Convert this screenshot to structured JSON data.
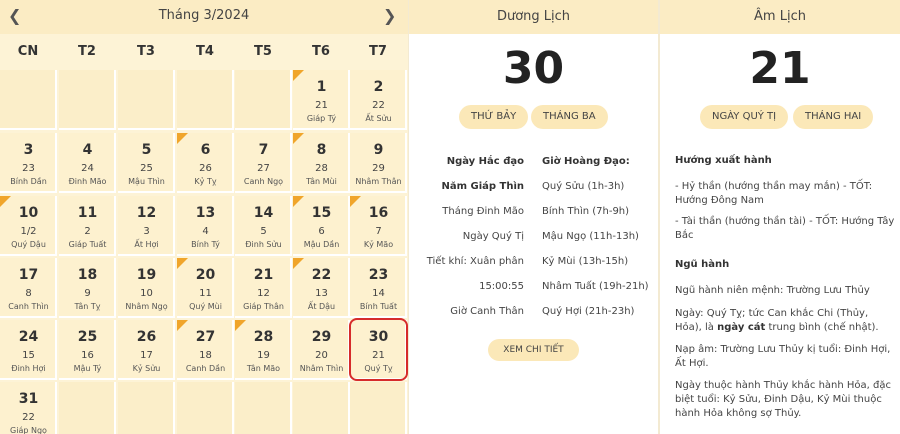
{
  "calendar": {
    "title": "Tháng 3/2024",
    "prev_icon": "chevron-left-icon",
    "next_icon": "chevron-right-icon",
    "weekdays": [
      "CN",
      "T2",
      "T3",
      "T4",
      "T5",
      "T6",
      "T7"
    ],
    "marker_color": "#f0a52b",
    "today_color": "#d62b2b",
    "days": [
      {
        "solar": "1",
        "lunar": "21",
        "canchi": "Giáp Tý",
        "marker": true
      },
      {
        "solar": "2",
        "lunar": "22",
        "canchi": "Ất Sửu",
        "marker": false
      },
      {
        "solar": "3",
        "lunar": "23",
        "canchi": "Bính Dần",
        "marker": false
      },
      {
        "solar": "4",
        "lunar": "24",
        "canchi": "Đinh Mão",
        "marker": false
      },
      {
        "solar": "5",
        "lunar": "25",
        "canchi": "Mậu Thìn",
        "marker": false
      },
      {
        "solar": "6",
        "lunar": "26",
        "canchi": "Kỷ Tỵ",
        "marker": true
      },
      {
        "solar": "7",
        "lunar": "27",
        "canchi": "Canh Ngọ",
        "marker": false
      },
      {
        "solar": "8",
        "lunar": "28",
        "canchi": "Tân Mùi",
        "marker": true
      },
      {
        "solar": "9",
        "lunar": "29",
        "canchi": "Nhâm Thân",
        "marker": false
      },
      {
        "solar": "10",
        "lunar": "1/2",
        "canchi": "Quý Dậu",
        "marker": true
      },
      {
        "solar": "11",
        "lunar": "2",
        "canchi": "Giáp Tuất",
        "marker": false
      },
      {
        "solar": "12",
        "lunar": "3",
        "canchi": "Ất Hợi",
        "marker": false
      },
      {
        "solar": "13",
        "lunar": "4",
        "canchi": "Bính Tý",
        "marker": false
      },
      {
        "solar": "14",
        "lunar": "5",
        "canchi": "Đinh Sửu",
        "marker": false
      },
      {
        "solar": "15",
        "lunar": "6",
        "canchi": "Mậu Dần",
        "marker": true
      },
      {
        "solar": "16",
        "lunar": "7",
        "canchi": "Kỷ Mão",
        "marker": true
      },
      {
        "solar": "17",
        "lunar": "8",
        "canchi": "Canh Thìn",
        "marker": false
      },
      {
        "solar": "18",
        "lunar": "9",
        "canchi": "Tân Tỵ",
        "marker": false
      },
      {
        "solar": "19",
        "lunar": "10",
        "canchi": "Nhâm Ngọ",
        "marker": false
      },
      {
        "solar": "20",
        "lunar": "11",
        "canchi": "Quý Mùi",
        "marker": true
      },
      {
        "solar": "21",
        "lunar": "12",
        "canchi": "Giáp Thân",
        "marker": false
      },
      {
        "solar": "22",
        "lunar": "13",
        "canchi": "Ất Dậu",
        "marker": true
      },
      {
        "solar": "23",
        "lunar": "14",
        "canchi": "Bính Tuất",
        "marker": false
      },
      {
        "solar": "24",
        "lunar": "15",
        "canchi": "Đinh Hợi",
        "marker": false
      },
      {
        "solar": "25",
        "lunar": "16",
        "canchi": "Mậu Tý",
        "marker": false
      },
      {
        "solar": "26",
        "lunar": "17",
        "canchi": "Kỷ Sửu",
        "marker": false
      },
      {
        "solar": "27",
        "lunar": "18",
        "canchi": "Canh Dần",
        "marker": true
      },
      {
        "solar": "28",
        "lunar": "19",
        "canchi": "Tân Mão",
        "marker": true
      },
      {
        "solar": "29",
        "lunar": "20",
        "canchi": "Nhâm Thìn",
        "marker": false
      },
      {
        "solar": "30",
        "lunar": "21",
        "canchi": "Quý Tỵ",
        "marker": false,
        "today": true
      },
      {
        "solar": "31",
        "lunar": "22",
        "canchi": "Giáp Ngọ",
        "marker": false
      }
    ]
  },
  "duong_lich": {
    "title": "Dương Lịch",
    "day": "30",
    "weekday_pill": "THỨ BẢY",
    "month_pill": "THÁNG BA",
    "left_col": [
      "Ngày Hắc đạo",
      "Năm Giáp Thìn",
      "Tháng Đinh Mão",
      "Ngày Quý Tị",
      "Tiết khí: Xuân phân",
      "15:00:55",
      "Giờ Canh Thân"
    ],
    "right_header": "Giờ Hoàng Đạo:",
    "hours": [
      "Quý Sửu (1h-3h)",
      "Bính Thìn (7h-9h)",
      "Mậu Ngọ (11h-13h)",
      "Kỷ Mùi (13h-15h)",
      "Nhâm Tuất (19h-21h)",
      "Quý Hợi (21h-23h)"
    ],
    "detail_button": "XEM CHI TIẾT"
  },
  "am_lich": {
    "title": "Âm Lịch",
    "day": "21",
    "day_pill": "NGÀY QUÝ TỊ",
    "month_pill": "THÁNG HAI",
    "section1": "Hướng xuất hành",
    "hy_than": "- Hỷ thần (hướng thần may mắn) - TỐT: Hướng Đông Nam",
    "tai_than": "- Tài thần (hướng thần tài) - TỐT: Hướng Tây Bắc",
    "section2": "Ngũ hành",
    "nien_menh": "Ngũ hành niên mệnh: Trường Lưu Thủy",
    "ngay_pre": "Ngày: Quý Tỵ; tức Can khắc Chi (Thủy, Hỏa), là",
    "ngay_bold": "ngày cát",
    "ngay_post": "trung bình (chế nhật).",
    "nap_am": "Nạp âm: Trường Lưu Thủy kị tuổi: Đinh Hợi, Ất Hợi.",
    "thuoc_hanh": "Ngày thuộc hành Thủy khắc hành Hỏa, đặc biệt tuổi: Kỷ Sửu, Đinh Dậu, Kỷ Mùi thuộc hành Hỏa không sợ Thủy."
  }
}
